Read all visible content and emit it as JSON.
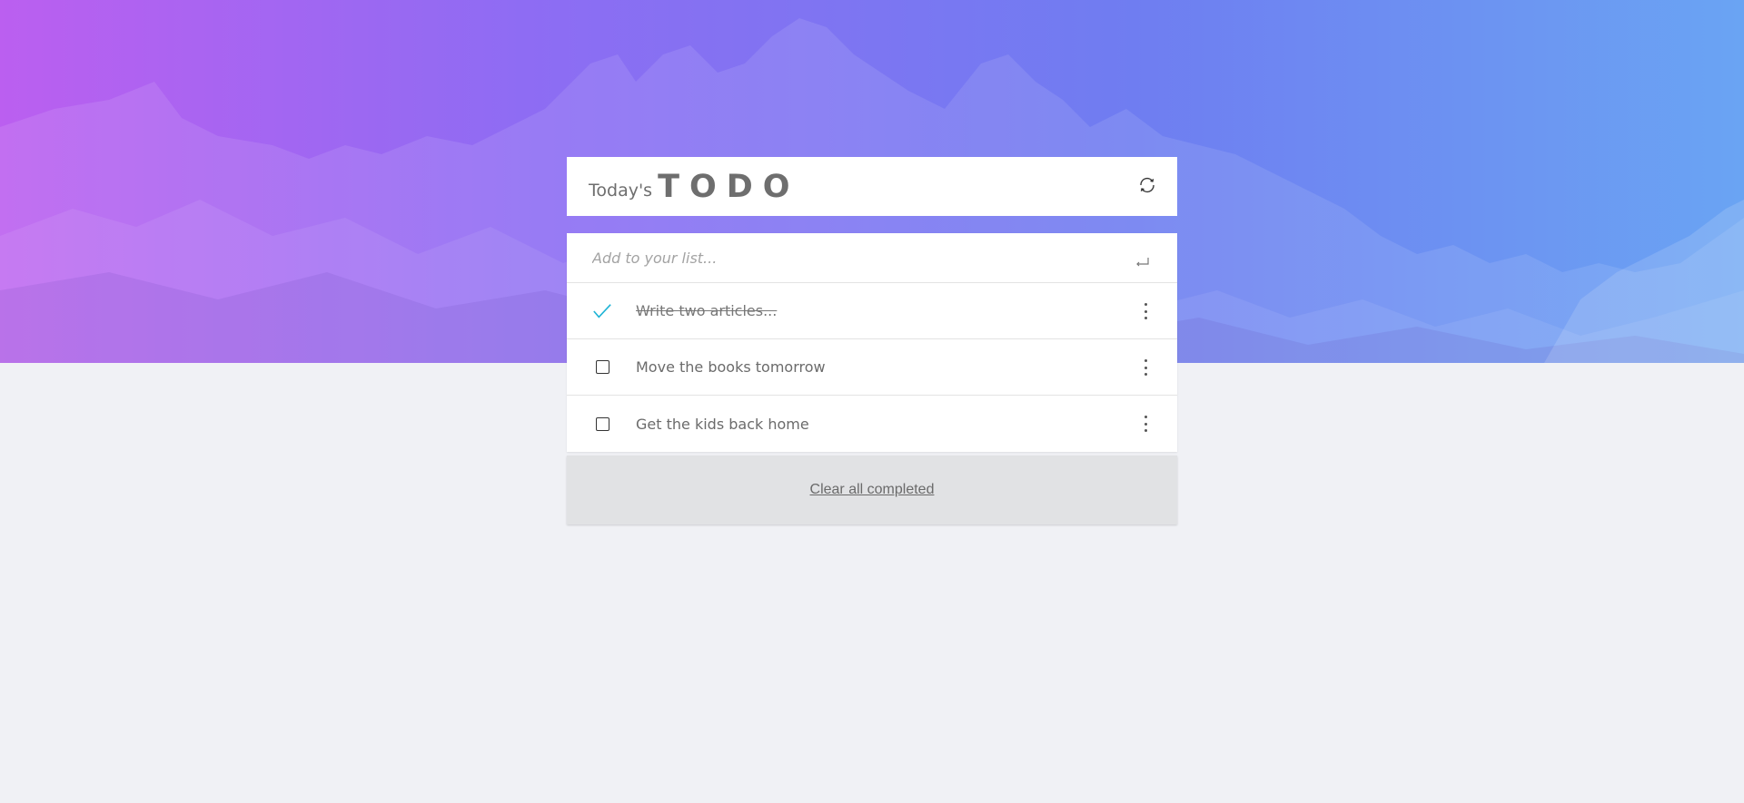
{
  "header": {
    "title_prefix": "Today's",
    "title": "TODO",
    "refresh_icon": "refresh-icon"
  },
  "input": {
    "placeholder": "Add to your list...",
    "enter_icon": "enter-icon"
  },
  "todos": [
    {
      "text": "Write two articles...",
      "completed": true
    },
    {
      "text": "Move the books tomorrow",
      "completed": false
    },
    {
      "text": "Get the kids back home",
      "completed": false
    }
  ],
  "footer": {
    "clear_label": "Clear all completed"
  },
  "colors": {
    "background": "#f0f1f5",
    "gradient_start": "#bb5ff0",
    "gradient_end": "#6aa4f3",
    "check_accent": "#1fb4d6",
    "text": "#6b6b6b"
  }
}
